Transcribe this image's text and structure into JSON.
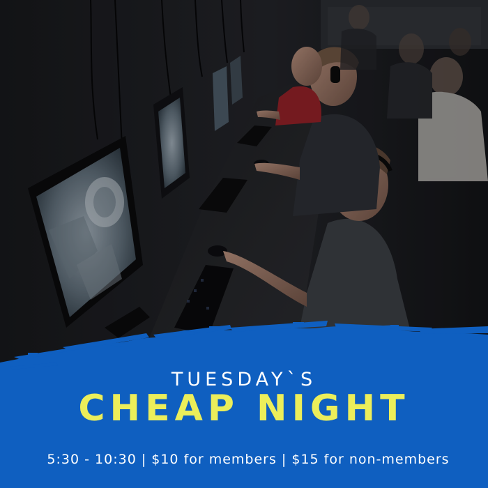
{
  "poster": {
    "subtitle": "TUESDAY`S",
    "headline": "CHEAP NIGHT",
    "details": "5:30 - 10:30 | $10 for members | $15 for non-members"
  },
  "colors": {
    "banner_blue": "#0f5fc0",
    "headline_yellow": "#ecee5a",
    "text_white": "#ffffff",
    "background_dark": "#0c0d0f"
  },
  "photo": {
    "subject": "gamers-at-computer-row-photo"
  }
}
